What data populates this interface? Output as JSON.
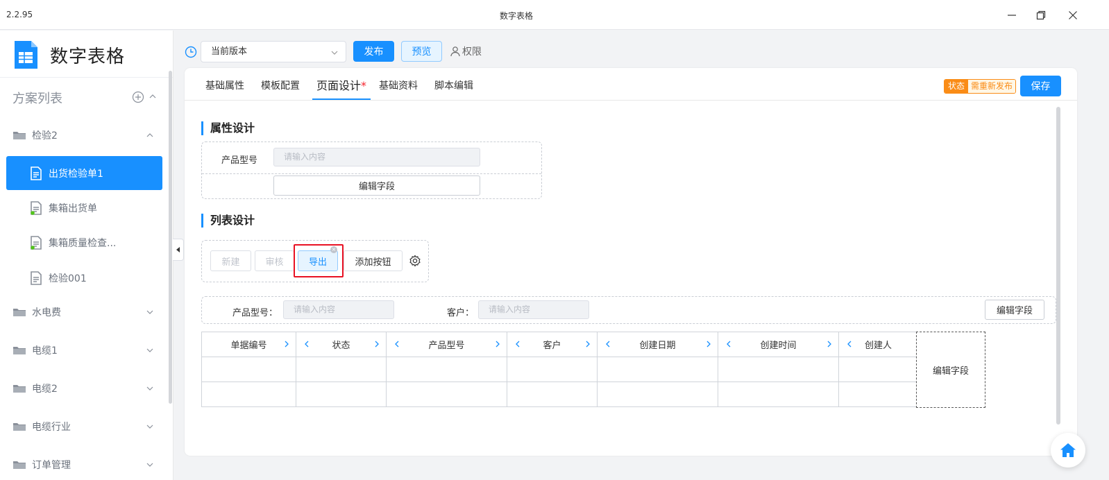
{
  "window": {
    "version": "2.2.95",
    "title": "数字表格"
  },
  "sidebar": {
    "brand": "数字表格",
    "section_title": "方案列表",
    "items": [
      {
        "label": "检验2",
        "type": "folder",
        "expanded": true
      },
      {
        "label": "出货检验单1",
        "type": "doc",
        "active": true
      },
      {
        "label": "集箱出货单",
        "type": "doc"
      },
      {
        "label": "集箱质量检查...",
        "type": "doc"
      },
      {
        "label": "检验001",
        "type": "doc"
      },
      {
        "label": "水电费",
        "type": "folder"
      },
      {
        "label": "电缆1",
        "type": "folder"
      },
      {
        "label": "电缆2",
        "type": "folder"
      },
      {
        "label": "电缆行业",
        "type": "folder"
      },
      {
        "label": "订单管理",
        "type": "folder"
      }
    ]
  },
  "toolbar": {
    "version_select": "当前版本",
    "publish_label": "发布",
    "preview_label": "预览",
    "permission_label": "权限"
  },
  "tabs": [
    {
      "label": "基础属性"
    },
    {
      "label": "模板配置"
    },
    {
      "label": "页面设计",
      "active": true,
      "marker": "*"
    },
    {
      "label": "基础资料"
    },
    {
      "label": "脚本编辑"
    }
  ],
  "status": {
    "key": "状态",
    "value": "需重新发布"
  },
  "save_label": "保存",
  "property_design": {
    "title": "属性设计",
    "field_label": "产品型号",
    "field_placeholder": "请输入内容",
    "edit_field_label": "编辑字段"
  },
  "list_design": {
    "title": "列表设计",
    "buttons": [
      "新建",
      "审核",
      "导出",
      "添加按钮"
    ],
    "filters": [
      {
        "label": "产品型号：",
        "placeholder": "请输入内容"
      },
      {
        "label": "客户：",
        "placeholder": "请输入内容"
      }
    ],
    "filter_edit_label": "编辑字段",
    "columns": [
      "单据编号",
      "状态",
      "产品型号",
      "客户",
      "创建日期",
      "创建时间",
      "创建人"
    ],
    "column_edit_label": "编辑字段"
  },
  "colors": {
    "primary": "#1890ff",
    "warning": "#fa8c16",
    "highlight": "#e81123"
  }
}
